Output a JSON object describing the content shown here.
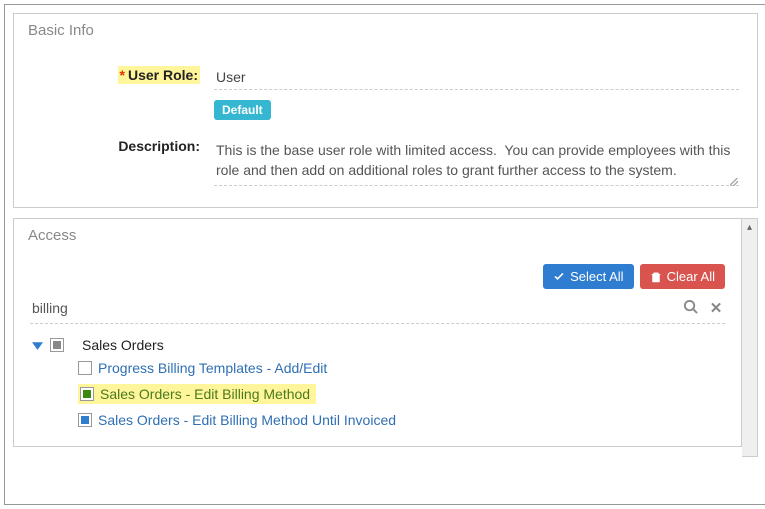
{
  "basic_info": {
    "title": "Basic Info",
    "user_role_label": "User Role:",
    "user_role_value": "User",
    "default_badge": "Default",
    "description_label": "Description:",
    "description_value": "This is the base user role with limited access.  You can provide employees with this role and then add on additional roles to grant further access to the system."
  },
  "access": {
    "title": "Access",
    "select_all_label": "Select All",
    "clear_all_label": "Clear All",
    "filter_value": "billing",
    "tree": {
      "root_label": "Sales Orders",
      "children": [
        {
          "label": "Progress Billing Templates - Add/Edit",
          "state": "unchecked"
        },
        {
          "label": "Sales Orders - Edit Billing Method",
          "state": "checked-green",
          "highlighted": true
        },
        {
          "label": "Sales Orders - Edit Billing Method Until Invoiced",
          "state": "checked"
        }
      ]
    }
  }
}
